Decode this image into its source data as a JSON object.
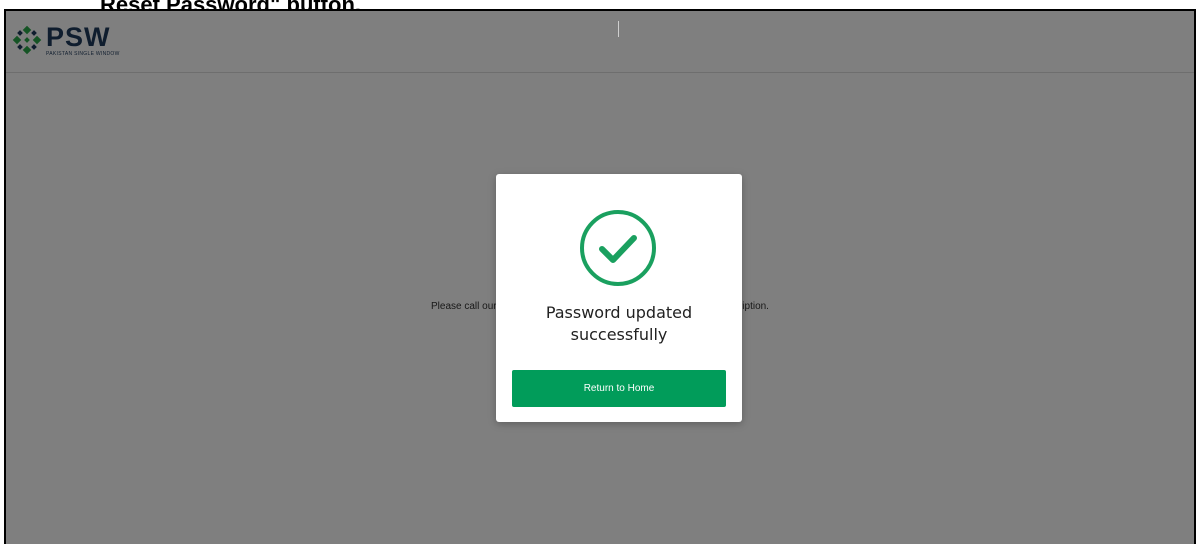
{
  "document": {
    "caption_fragment": "Reset Password\" button."
  },
  "header": {
    "logo_text": "PSW",
    "logo_subtitle": "PAKISTAN SINGLE WINDOW"
  },
  "page": {
    "message": "Please call our helpline for any assistance regarding your PSW subscription."
  },
  "modal": {
    "icon": "check-circle-icon",
    "title": "Password updated successfully",
    "button_label": "Return to Home"
  },
  "colors": {
    "accent": "#019c5a",
    "check_icon": "#1aa05f",
    "logo_text": "#1e3a5c",
    "logo_mark_green": "#2aa84a",
    "logo_mark_navy": "#1e3a5c",
    "overlay": "rgba(0,0,0,0.5)"
  }
}
